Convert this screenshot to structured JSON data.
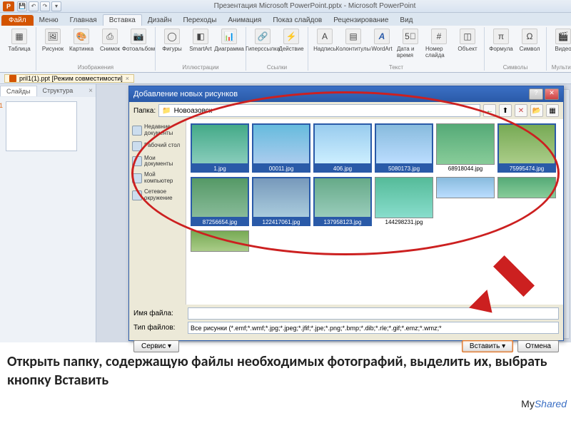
{
  "titlebar": {
    "title": "Презентация Microsoft PowerPoint.pptx - Microsoft PowerPoint",
    "logo_letter": "P"
  },
  "ribbon": {
    "file_label": "Файл",
    "tabs": [
      "Меню",
      "Главная",
      "Вставка",
      "Дизайн",
      "Переходы",
      "Анимация",
      "Показ слайдов",
      "Рецензирование",
      "Вид"
    ],
    "active_tab_index": 2,
    "groups": [
      {
        "label": "",
        "items": [
          "Таблица"
        ]
      },
      {
        "label": "Изображения",
        "items": [
          "Рисунок",
          "Картинка",
          "Снимок",
          "Фотоальбом"
        ]
      },
      {
        "label": "Иллюстрации",
        "items": [
          "Фигуры",
          "SmartArt",
          "Диаграмма"
        ]
      },
      {
        "label": "Ссылки",
        "items": [
          "Гиперссылка",
          "Действие"
        ]
      },
      {
        "label": "Текст",
        "items": [
          "Надпись",
          "Колонтитулы",
          "WordArt",
          "Дата и время",
          "Номер слайда",
          "Объект"
        ]
      },
      {
        "label": "Символы",
        "items": [
          "Формула",
          "Символ"
        ]
      },
      {
        "label": "Мультим",
        "items": [
          "Видео"
        ]
      }
    ]
  },
  "doc_tab": {
    "label": "pril1(1).ppt [Режим совместимости]"
  },
  "slides_panel": {
    "tabs": [
      "Слайды",
      "Структура"
    ],
    "slide_number": "1"
  },
  "dialog": {
    "title": "Добавление новых рисунков",
    "folder_label": "Папка:",
    "folder_value": "Новоазовск",
    "places": [
      "Недавние документы",
      "Рабочий стол",
      "Мои документы",
      "Мой компьютер",
      "Сетевое окружение"
    ],
    "files": [
      {
        "name": "1.jpg",
        "sel": true
      },
      {
        "name": "00011.jpg",
        "sel": true
      },
      {
        "name": "406.jpg",
        "sel": true
      },
      {
        "name": "5080173.jpg",
        "sel": true
      },
      {
        "name": "68918044.jpg",
        "sel": false
      },
      {
        "name": "75995474.jpg",
        "sel": true
      },
      {
        "name": "87256654.jpg",
        "sel": true
      },
      {
        "name": "122417061.jpg",
        "sel": true
      },
      {
        "name": "137958123.jpg",
        "sel": true
      },
      {
        "name": "144298231.jpg",
        "sel": false
      }
    ],
    "filename_label": "Имя файла:",
    "filename_value": "",
    "filetype_label": "Тип файлов:",
    "filetype_value": "Все рисунки (*.emf;*.wmf;*.jpg;*.jpeg;*.jfif;*.jpe;*.png;*.bmp;*.dib;*.rle;*.gif;*.emz;*.wmz;*",
    "service_btn": "Сервис",
    "insert_btn": "Вставить",
    "cancel_btn": "Отмена"
  },
  "caption": "Открыть папку, содержащую файлы необходимых  фотографий, выделить их, выбрать кнопку Вставить",
  "watermark_prefix": "My",
  "watermark_suffix": "Shared"
}
